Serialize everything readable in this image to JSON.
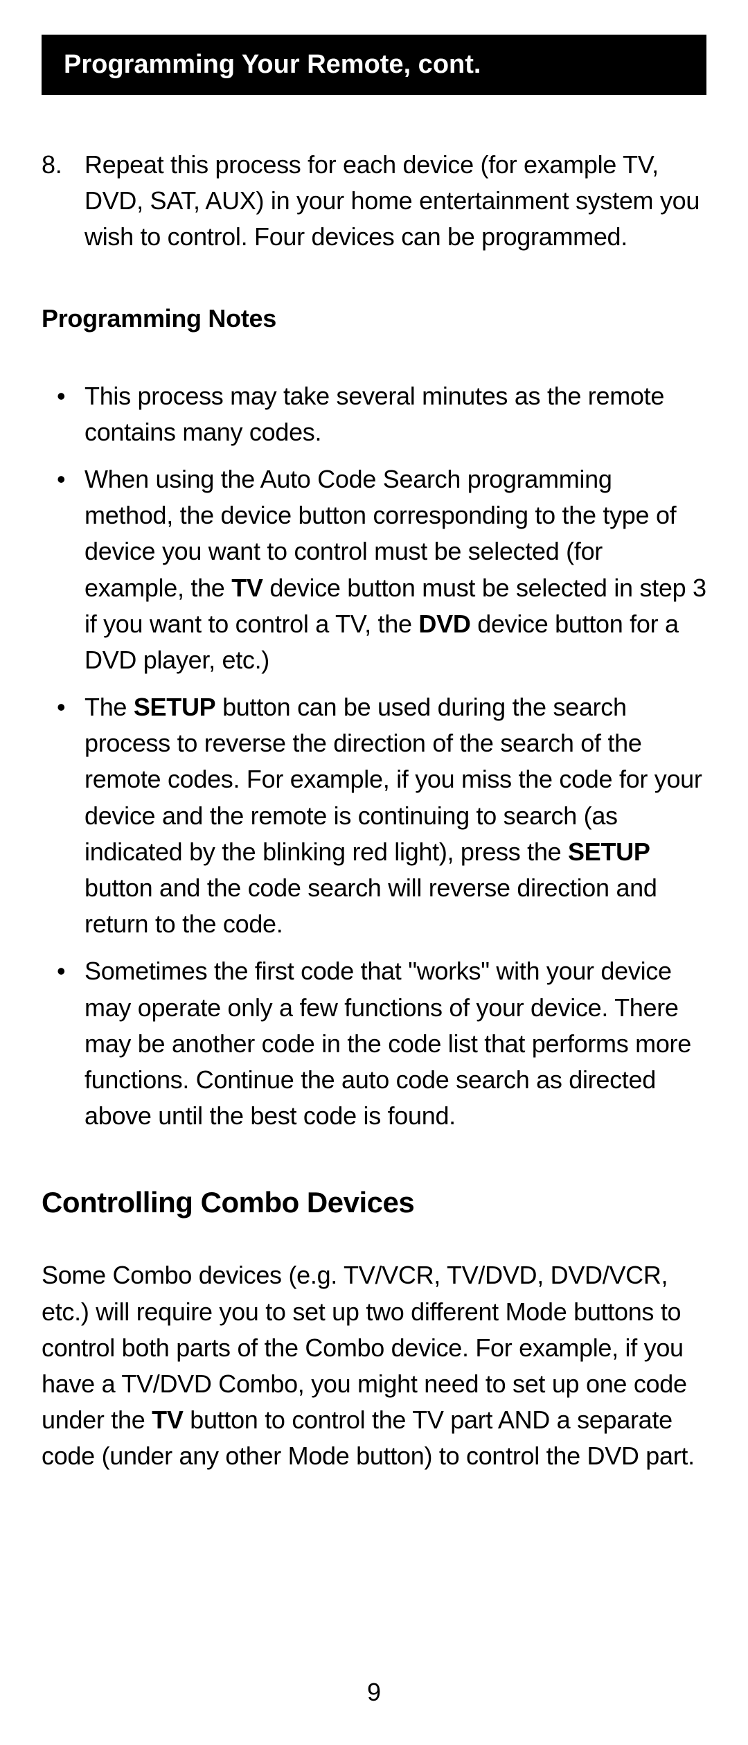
{
  "header": {
    "title": "Programming Your Remote, cont."
  },
  "step8": {
    "number": "8.",
    "text": "Repeat this process for each device (for example TV, DVD, SAT, AUX) in your home entertainment system you wish to control. Four devices can be programmed."
  },
  "notes": {
    "heading": "Programming Notes",
    "bullets": {
      "b1": "This process may take several minutes as the remote contains many codes.",
      "b2_p1": "When using the Auto Code Search programming method, the device button corresponding to the type of device you want to control must be selected (for example, the ",
      "b2_bold1": "TV",
      "b2_p2": " device button must be selected in step 3 if you want to control a TV, the ",
      "b2_bold2": "DVD",
      "b2_p3": " device button for a DVD player, etc.)",
      "b3_p1": "The ",
      "b3_bold1": "SETUP",
      "b3_p2": " button can be used during the search process to reverse the direction of the search of the remote codes. For example, if you miss the code for your device and the remote is continuing to search (as indicated by the blinking red light), press the ",
      "b3_bold2": "SETUP",
      "b3_p3": " button and the code search will reverse direction and return to the code.",
      "b4": "Sometimes the first code that \"works\" with your device may operate only a few functions of your device. There may be another code in the code list that performs more functions. Continue the auto code search as directed above until the best code is found."
    }
  },
  "combo": {
    "heading": "Controlling Combo Devices",
    "p1": "Some Combo devices (e.g. TV/VCR, TV/DVD, DVD/VCR, etc.) will require you to set up two different Mode buttons to control both parts of the Combo device. For example, if you have a TV/DVD Combo, you might need to set up one code under the ",
    "bold1": "TV",
    "p2": " button to control the TV part AND a separate code (under any other Mode button) to control the DVD part."
  },
  "pageNumber": "9"
}
